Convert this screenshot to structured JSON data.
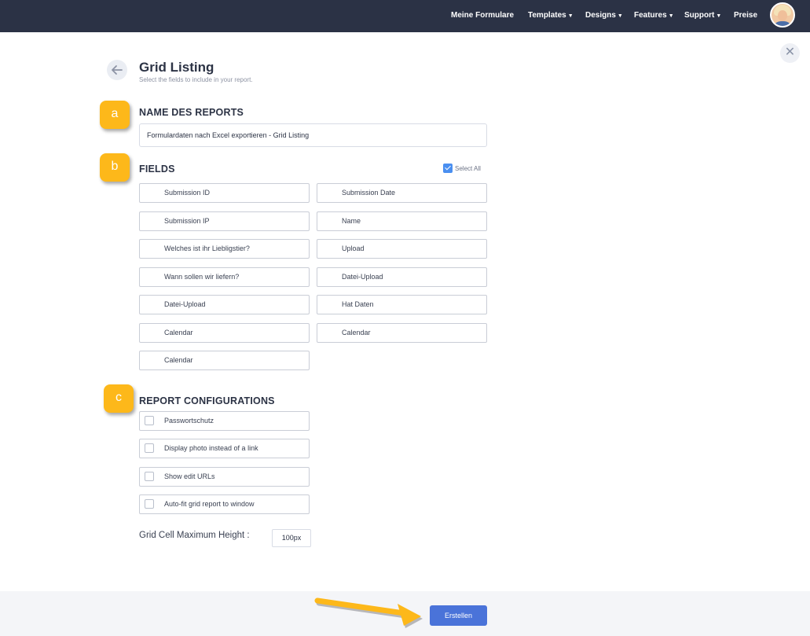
{
  "nav": {
    "my_forms": "Meine Formulare",
    "templates": "Templates",
    "designs": "Designs",
    "features": "Features",
    "support": "Support",
    "pricing": "Preise"
  },
  "header": {
    "title": "Grid Listing",
    "subtitle": "Select the fields to include in your report."
  },
  "badges": {
    "a": "a",
    "b": "b",
    "c": "c"
  },
  "report_name": {
    "heading": "NAME DES REPORTS",
    "value": "Formulardaten nach Excel exportieren - Grid Listing"
  },
  "fields": {
    "heading": "FIELDS",
    "select_all_label": "Select All",
    "select_all_checked": true,
    "items": [
      {
        "label": "Submission ID",
        "checked": true
      },
      {
        "label": "Submission Date",
        "checked": true
      },
      {
        "label": "Submission IP",
        "checked": true
      },
      {
        "label": "Name",
        "checked": true
      },
      {
        "label": "Welches ist ihr Liebligstier?",
        "checked": true
      },
      {
        "label": "Upload",
        "checked": true
      },
      {
        "label": "Wann sollen wir liefern?",
        "checked": true
      },
      {
        "label": "Datei-Upload",
        "checked": true
      },
      {
        "label": "Datei-Upload",
        "checked": true
      },
      {
        "label": "Hat Daten",
        "checked": true
      },
      {
        "label": "Calendar",
        "checked": true
      },
      {
        "label": "Calendar",
        "checked": true
      },
      {
        "label": "Calendar",
        "checked": true
      }
    ]
  },
  "config": {
    "heading": "REPORT CONFIGURATIONS",
    "items": [
      {
        "label": "Passwortschutz",
        "checked": false
      },
      {
        "label": "Display photo instead of a link",
        "checked": false
      },
      {
        "label": "Show edit URLs",
        "checked": false
      },
      {
        "label": "Auto-fit grid report to window",
        "checked": false
      }
    ],
    "cell_height_label": "Grid Cell Maximum Height :",
    "cell_height_value": "100px"
  },
  "footer": {
    "submit_label": "Erstellen"
  },
  "colors": {
    "topbar": "#2b3245",
    "accent": "#4a8ff0",
    "submit": "#4a73d9",
    "badge": "#fdb81a"
  }
}
